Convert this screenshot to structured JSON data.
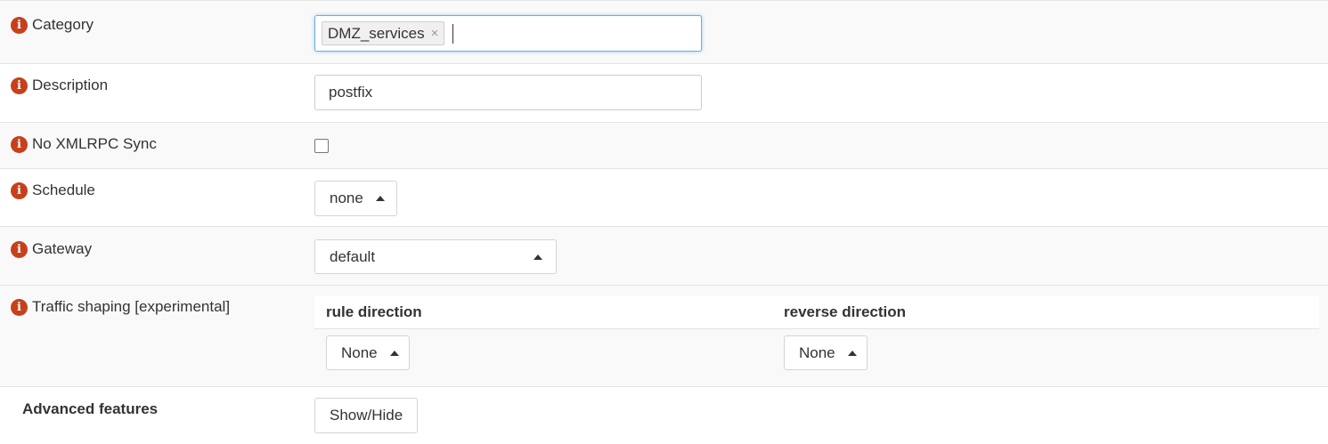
{
  "fields": {
    "category": {
      "label": "Category",
      "tags": [
        "DMZ_services"
      ],
      "tag_remove_glyph": "×"
    },
    "description": {
      "label": "Description",
      "value": "postfix"
    },
    "no_xmlrpc_sync": {
      "label": "No XMLRPC Sync",
      "checked": false
    },
    "schedule": {
      "label": "Schedule",
      "selected": "none"
    },
    "gateway": {
      "label": "Gateway",
      "selected": "default"
    },
    "traffic_shaping": {
      "label": "Traffic shaping [experimental]",
      "rule_direction_header": "rule direction",
      "reverse_direction_header": "reverse direction",
      "rule_direction_selected": "None",
      "reverse_direction_selected": "None"
    },
    "advanced": {
      "label": "Advanced features",
      "button_label": "Show/Hide"
    }
  },
  "icons": {
    "info": "info-icon",
    "dropdown": "caret-up-icon",
    "remove_tag": "close-icon"
  },
  "colors": {
    "info_icon": "#c7401c",
    "focus_border": "#66afe9",
    "row_alt_bg": "#f9f9f9"
  }
}
